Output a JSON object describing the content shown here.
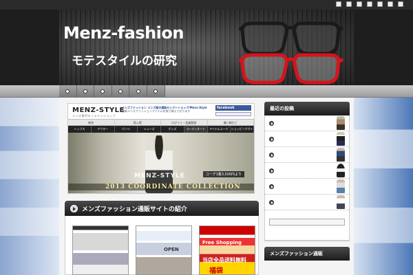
{
  "site": {
    "title": "Menz-fashion",
    "subtitle": "モテスタイルの研究"
  },
  "header_icons": [
    "share-icon",
    "share-icon",
    "share-icon",
    "share-icon",
    "share-icon",
    "share-icon",
    "share-icon"
  ],
  "nav": {
    "item_count": 6
  },
  "shop": {
    "logo": "MENZ-STYLE",
    "logo_sub": "メンズ専門オンラインショップ",
    "info_line1": "メンズファッション メンズ服の通販セレクトショップ/Menz-Style",
    "info_line2": "最新メンズファッションアイテムを取り揃えております",
    "facebook": "facebook",
    "menu_top": [
      "新作",
      "再入荷",
      "ログイン・会員登録",
      "買い物かご"
    ],
    "menu_main": [
      "トップス",
      "アウター",
      "パンツ",
      "シューズ",
      "グッズ",
      "コーディネート",
      "アイテムコーデ",
      "ショッピングガイド"
    ],
    "hero_logo": "MENZ-STYLE",
    "hero_collection": "2013 COORDINATE COLLECTION",
    "hero_price": "コーデ1着3,500円より"
  },
  "post": {
    "title": "メンズファッション通販サイトの紹介"
  },
  "thumb3": {
    "line1": "Free Shopping",
    "line2": "当店全品送料無料",
    "line3": "福袋"
  },
  "sidebar": {
    "widget1_title": "最近の投稿",
    "widget2_title": "メンズファッション通販"
  }
}
